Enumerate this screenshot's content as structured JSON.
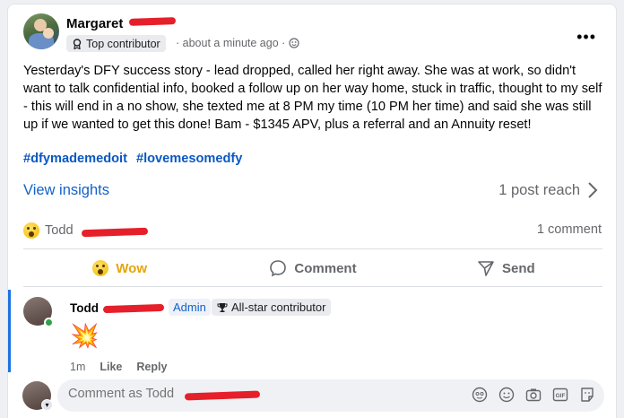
{
  "post": {
    "author_name": "Margaret",
    "badge_label": "Top contributor",
    "time": "· about a minute ago ·",
    "more_label": "•••",
    "body": "Yesterday's DFY success story - lead dropped, called her right away.  She was at work, so didn't want to talk confidential info, booked a follow up on her way home, stuck in traffic, thought to my self - this will end in a no show, she texted me at 8 PM my time (10 PM her time) and said she was still up if we wanted to get this done!  Bam - $1345 APV, plus a referral and an Annuity reset!",
    "hashtags": [
      "#dfymademedoit",
      "#lovemesomedfy"
    ]
  },
  "insights": {
    "view_label": "View insights",
    "reach_label": "1 post reach"
  },
  "reactions": {
    "reactor_name": "Todd",
    "comment_count": "1 comment"
  },
  "actions": {
    "wow_label": "Wow",
    "comment_label": "Comment",
    "send_label": "Send"
  },
  "comment": {
    "author_name": "Todd",
    "admin_label": "Admin",
    "allstar_label": "All-star contributor",
    "content_emoji": "💥",
    "time": "1m",
    "like_label": "Like",
    "reply_label": "Reply"
  },
  "composer": {
    "placeholder": "Comment as Todd"
  },
  "colors": {
    "link_blue": "#1262c9",
    "hashtag_blue": "#0a58c2",
    "wow_yellow": "#e5a40b",
    "redact_red": "#e5202a",
    "online_green": "#31a24c"
  },
  "icons": [
    "more-options-icon",
    "contributor-badge-icon",
    "globe-icon",
    "chevron-right-icon",
    "wow-reaction-icon",
    "comment-icon",
    "send-icon",
    "trophy-icon",
    "avatar-sticker-icon",
    "emoji-icon",
    "camera-icon",
    "gif-icon",
    "sticker-icon"
  ]
}
